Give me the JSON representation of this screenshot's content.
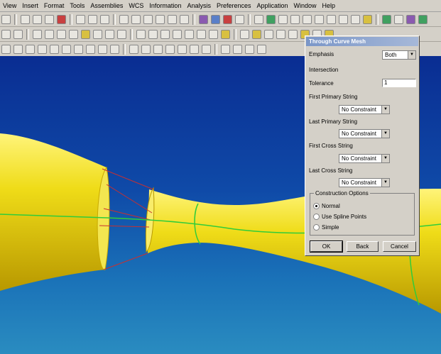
{
  "menu": [
    "View",
    "Insert",
    "Format",
    "Tools",
    "Assemblies",
    "WCS",
    "Information",
    "Analysis",
    "Preferences",
    "Application",
    "Window",
    "Help"
  ],
  "dialog": {
    "title": "Through Curve Mesh",
    "emphasis_label": "Emphasis",
    "emphasis_value": "Both",
    "intersection_label": "Intersection",
    "tolerance_label": "Tolerance",
    "tolerance_value": "1",
    "first_primary_label": "First Primary String",
    "first_primary_value": "No Constraint",
    "last_primary_label": "Last Primary String",
    "last_primary_value": "No Constraint",
    "first_cross_label": "First Cross String",
    "first_cross_value": "No Constraint",
    "last_cross_label": "Last Cross String",
    "last_cross_value": "No Constraint",
    "construction_label": "Construction Options",
    "options": [
      "Normal",
      "Use Spline Points",
      "Simple"
    ],
    "selected_option": "Normal",
    "ok_label": "OK",
    "back_label": "Back",
    "cancel_label": "Cancel"
  },
  "colors": {
    "surface": "#e8d410",
    "background": "#0a2d8c",
    "curve_green": "#2fcc3a",
    "curve_red": "#c83030"
  }
}
